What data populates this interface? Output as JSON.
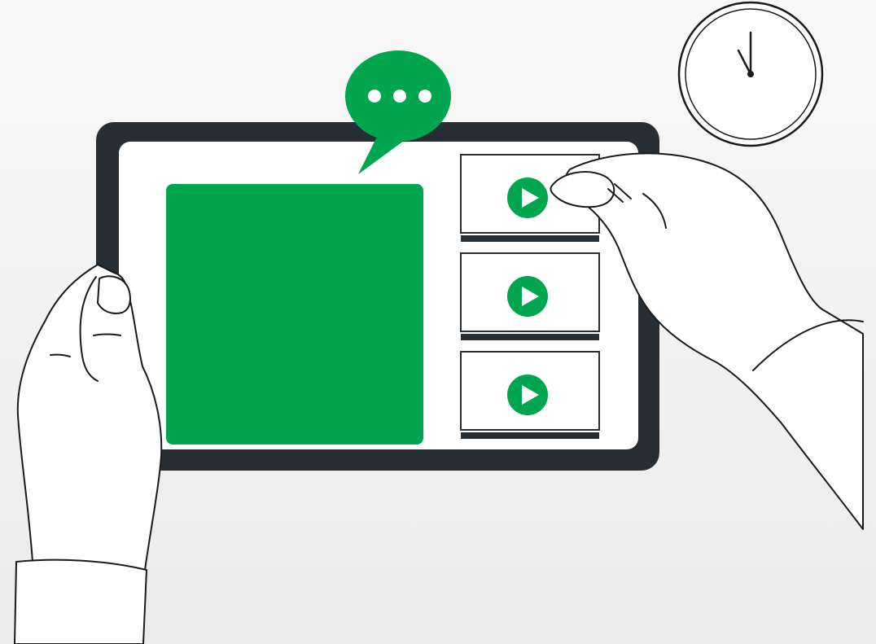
{
  "illustration": {
    "colors": {
      "background_top": "#f7f7f7",
      "background_bottom": "#ececec",
      "tablet_frame": "#262e33",
      "screen": "#ffffff",
      "accent_green": "#00a550",
      "line": "#1a1a1a"
    },
    "icons": {
      "speech_bubble": "speech-bubble-typing-icon",
      "clock": "wall-clock-icon",
      "play": "play-icon"
    },
    "playlist": [
      {
        "id": "video-1"
      },
      {
        "id": "video-2"
      },
      {
        "id": "video-3"
      }
    ]
  }
}
